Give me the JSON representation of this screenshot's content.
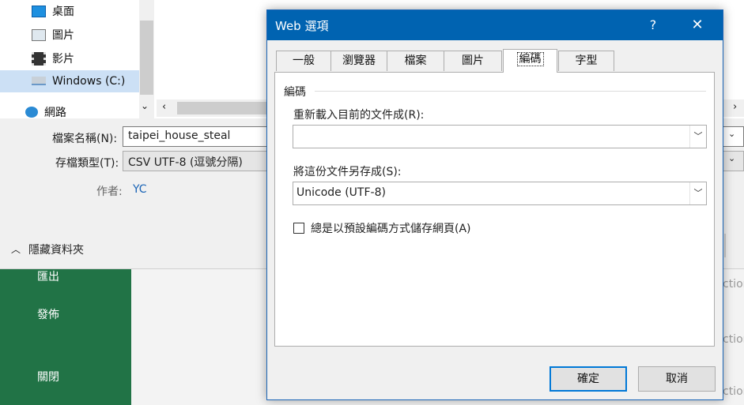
{
  "save_dialog": {
    "nav_items": [
      {
        "label": "桌面",
        "icon": "desktop-icon"
      },
      {
        "label": "圖片",
        "icon": "pictures-icon"
      },
      {
        "label": "影片",
        "icon": "videos-icon"
      },
      {
        "label": "Windows (C:)",
        "icon": "drive-icon"
      },
      {
        "label": "網路",
        "icon": "network-icon"
      }
    ],
    "filename_label": "檔案名稱(N):",
    "filename_value": "taipei_house_steal",
    "filetype_label": "存檔類型(T):",
    "filetype_value": "CSV UTF-8 (逗號分隔)",
    "author_label": "作者:",
    "author_value": "YC",
    "hide_folders": "隱藏資料夾"
  },
  "backstage": {
    "items": [
      "匯出",
      "發佈",
      "關閉"
    ],
    "peek": [
      "ction",
      "ction",
      "ction"
    ]
  },
  "web_options": {
    "title": "Web 選項",
    "help": "?",
    "close": "✕",
    "tabs": [
      "一般",
      "瀏覽器",
      "檔案",
      "圖片",
      "編碼",
      "字型"
    ],
    "active_tab": "編碼",
    "group_title": "編碼",
    "reload_label": "重新載入目前的文件成(R):",
    "reload_value": "",
    "save_as_label": "將這份文件另存成(S):",
    "save_as_value": "Unicode (UTF-8)",
    "checkbox_label": "總是以預設編碼方式儲存網頁(A)",
    "ok": "確定",
    "cancel": "取消"
  },
  "colors": {
    "excel_green": "#217346",
    "title_blue": "#0063b1"
  }
}
